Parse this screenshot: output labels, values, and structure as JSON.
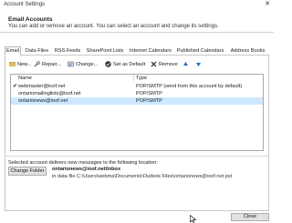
{
  "window": {
    "title": "Account Settings",
    "close_glyph": "✕"
  },
  "header": {
    "title": "Email Accounts",
    "description": "You can add or remove an account. You can select an account and change its settings."
  },
  "tabs": [
    {
      "label": "Email",
      "active": true
    },
    {
      "label": "Data Files",
      "active": false
    },
    {
      "label": "RSS Feeds",
      "active": false
    },
    {
      "label": "SharePoint Lists",
      "active": false
    },
    {
      "label": "Internet Calendars",
      "active": false
    },
    {
      "label": "Published Calendars",
      "active": false
    },
    {
      "label": "Address Books",
      "active": false
    }
  ],
  "toolbar": {
    "new_label": "New...",
    "repair_label": "Repair...",
    "change_label": "Change...",
    "default_label": "Set as Default",
    "remove_label": "Remove",
    "accent_color": "#1e6fd1"
  },
  "accounts": {
    "col_name": "Name",
    "col_type": "Type",
    "rows": [
      {
        "name": "webmaster@ioof.net",
        "type": "POP/SMTP (send from this account by default)",
        "default": true,
        "check": "✔"
      },
      {
        "name": "ontariomailinglists@ioof.net",
        "type": "POP/SMTP",
        "default": false,
        "check": ""
      },
      {
        "name": "ontarionews@ioof.net",
        "type": "POP/SMTP",
        "default": false,
        "check": ""
      }
    ],
    "selected_index": 2,
    "selected_color": "#cde8ff"
  },
  "delivery": {
    "text": "Selected account delivers new messages to the following location:",
    "button_label": "Change Folder",
    "folder": "ontarionews@ioof.net\\Inbox",
    "path": "in data file C:\\Users\\webma\\Documents\\Outlook Files\\ontarionews@ioof.net.pst"
  },
  "footer": {
    "close_label": "Close"
  }
}
